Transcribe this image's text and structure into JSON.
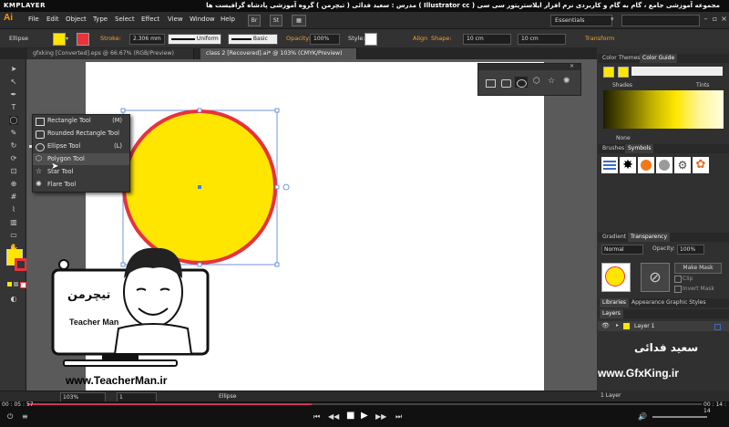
{
  "player": {
    "logo": "KMPLAYER",
    "title": "مجموعه آموزشی جامع ، گام به گام و کاربردی نرم افزار ایلاستریتور سی سی ( Illustrator cc ) مدرس : سعید فدائی ( تیچرمن ) گروه آموزشی پادشاه گرافیست ها",
    "time_current": "00 : 05 : 57",
    "time_total": "00 : 14 : 14",
    "progress": 0.42,
    "colors": {
      "progress": "#d42e5a"
    }
  },
  "menubar": {
    "app_logo": "Ai",
    "items": [
      "File",
      "Edit",
      "Object",
      "Type",
      "Select",
      "Effect",
      "View",
      "Window",
      "Help"
    ],
    "bridge": "Br",
    "stock": "St",
    "workspace": "Essentials"
  },
  "controlbar": {
    "label": "Ellipse",
    "stroke_label": "Stroke:",
    "stroke_value": "2.306 mm",
    "profile": "Uniform",
    "brush": "Basic",
    "opacity_label": "Opacity:",
    "opacity_value": "100%",
    "style_label": "Style:",
    "align_label": "Align",
    "shape_label": "Shape:",
    "width_value": "10 cm",
    "height_value": "10 cm",
    "transform_label": "Transform",
    "colors": {
      "fill": "#ffe600",
      "stroke": "#e8323c"
    }
  },
  "tabs": [
    {
      "label": "gfxking [Converted].eps @ 66.67% (RGB/Preview)",
      "active": false
    },
    {
      "label": "class 2 [Recovered].ai* @ 103% (CMYK/Preview)",
      "active": true
    }
  ],
  "flyout": {
    "items": [
      {
        "label": "Rectangle Tool",
        "key": "(M)",
        "icon": "rectangle-icon"
      },
      {
        "label": "Rounded Rectangle Tool",
        "key": "",
        "icon": "rounded-rectangle-icon"
      },
      {
        "label": "Ellipse Tool",
        "key": "(L)",
        "icon": "ellipse-icon"
      },
      {
        "label": "Polygon Tool",
        "key": "",
        "icon": "polygon-icon"
      },
      {
        "label": "Star Tool",
        "key": "",
        "icon": "star-icon"
      },
      {
        "label": "Flare Tool",
        "key": "",
        "icon": "flare-icon"
      }
    ]
  },
  "artwork": {
    "circle_fill": "#ffe600",
    "circle_stroke": "#e8323c",
    "teacher_logo_text": "تیچرمن",
    "teacher_name": "Teacher Man",
    "teacher_url": "www.TeacherMan.ir",
    "gfxking_name": "سعید فدائی",
    "gfxking_url": "www.GfxKing.ir"
  },
  "panels": {
    "color_tabs": [
      "Color Themes",
      "Color Guide"
    ],
    "shades_label": "Shades",
    "tints_label": "Tints",
    "none_label": "None",
    "brush_tabs": [
      "Brushes",
      "Symbols"
    ],
    "gradient_tabs": [
      "Gradient",
      "Transparency"
    ],
    "blend_mode": "Normal",
    "opacity_label": "Opacity:",
    "opacity_value": "100%",
    "make_mask": "Make Mask",
    "clip_label": "Clip",
    "invert_mask_label": "Invert Mask",
    "lib_tabs": [
      "Libraries",
      "Appearance",
      "Graphic Styles"
    ],
    "layers_tab": "Layers",
    "layer_name": "Layer 1",
    "layers_count": "1 Layer"
  },
  "status": {
    "zoom": "103%",
    "page": "1",
    "tool": "Ellipse"
  }
}
